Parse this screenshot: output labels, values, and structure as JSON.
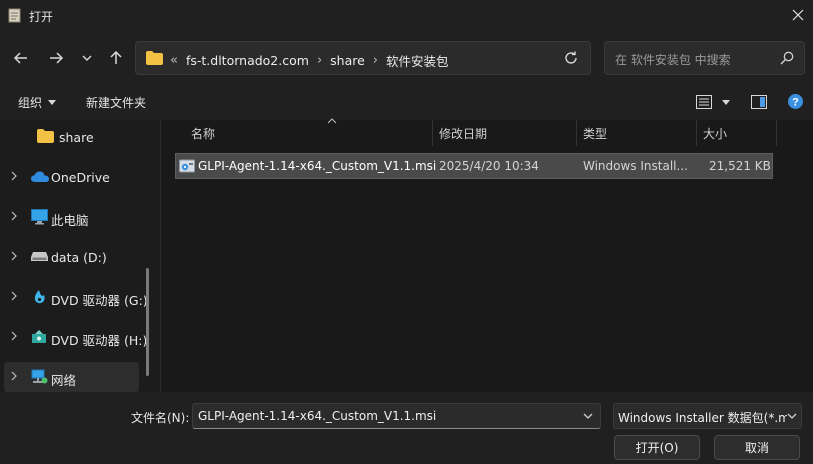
{
  "window": {
    "title": "打开"
  },
  "navigation": {
    "breadcrumb_prefix": "«",
    "breadcrumbs": [
      "fs-t.dltornado2.com",
      "share",
      "软件安装包"
    ],
    "separator": "›",
    "search_placeholder": "在 软件安装包 中搜索"
  },
  "commandbar": {
    "organize_label": "组织",
    "new_folder_label": "新建文件夹"
  },
  "sidebar": {
    "items": [
      {
        "label": "share",
        "icon": "folder-icon"
      },
      {
        "label": "OneDrive",
        "icon": "cloud-icon"
      },
      {
        "label": "此电脑",
        "icon": "computer-icon"
      },
      {
        "label": "data (D:)",
        "icon": "drive-icon"
      },
      {
        "label": "DVD 驱动器 (G:)",
        "icon": "dvd-icon"
      },
      {
        "label": "DVD 驱动器 (H:)",
        "icon": "dvd-icon"
      },
      {
        "label": "网络",
        "icon": "network-icon"
      }
    ]
  },
  "filelist": {
    "columns": [
      "名称",
      "修改日期",
      "类型",
      "大小"
    ],
    "rows": [
      {
        "name": "GLPI-Agent-1.14-x64._Custom_V1.1.msi",
        "modified": "2025/4/20 10:34",
        "type": "Windows Install...",
        "size": "21,521 KB"
      }
    ]
  },
  "footer": {
    "filename_label": "文件名(N):",
    "filename_value": "GLPI-Agent-1.14-x64._Custom_V1.1.msi",
    "filetype_value": "Windows Installer 数据包(*.msi)",
    "open_label": "打开(O)",
    "cancel_label": "取消"
  },
  "colors": {
    "selected_row": "#4a4a4a",
    "folder": "#f3c244",
    "help": "#3b8fe0"
  }
}
